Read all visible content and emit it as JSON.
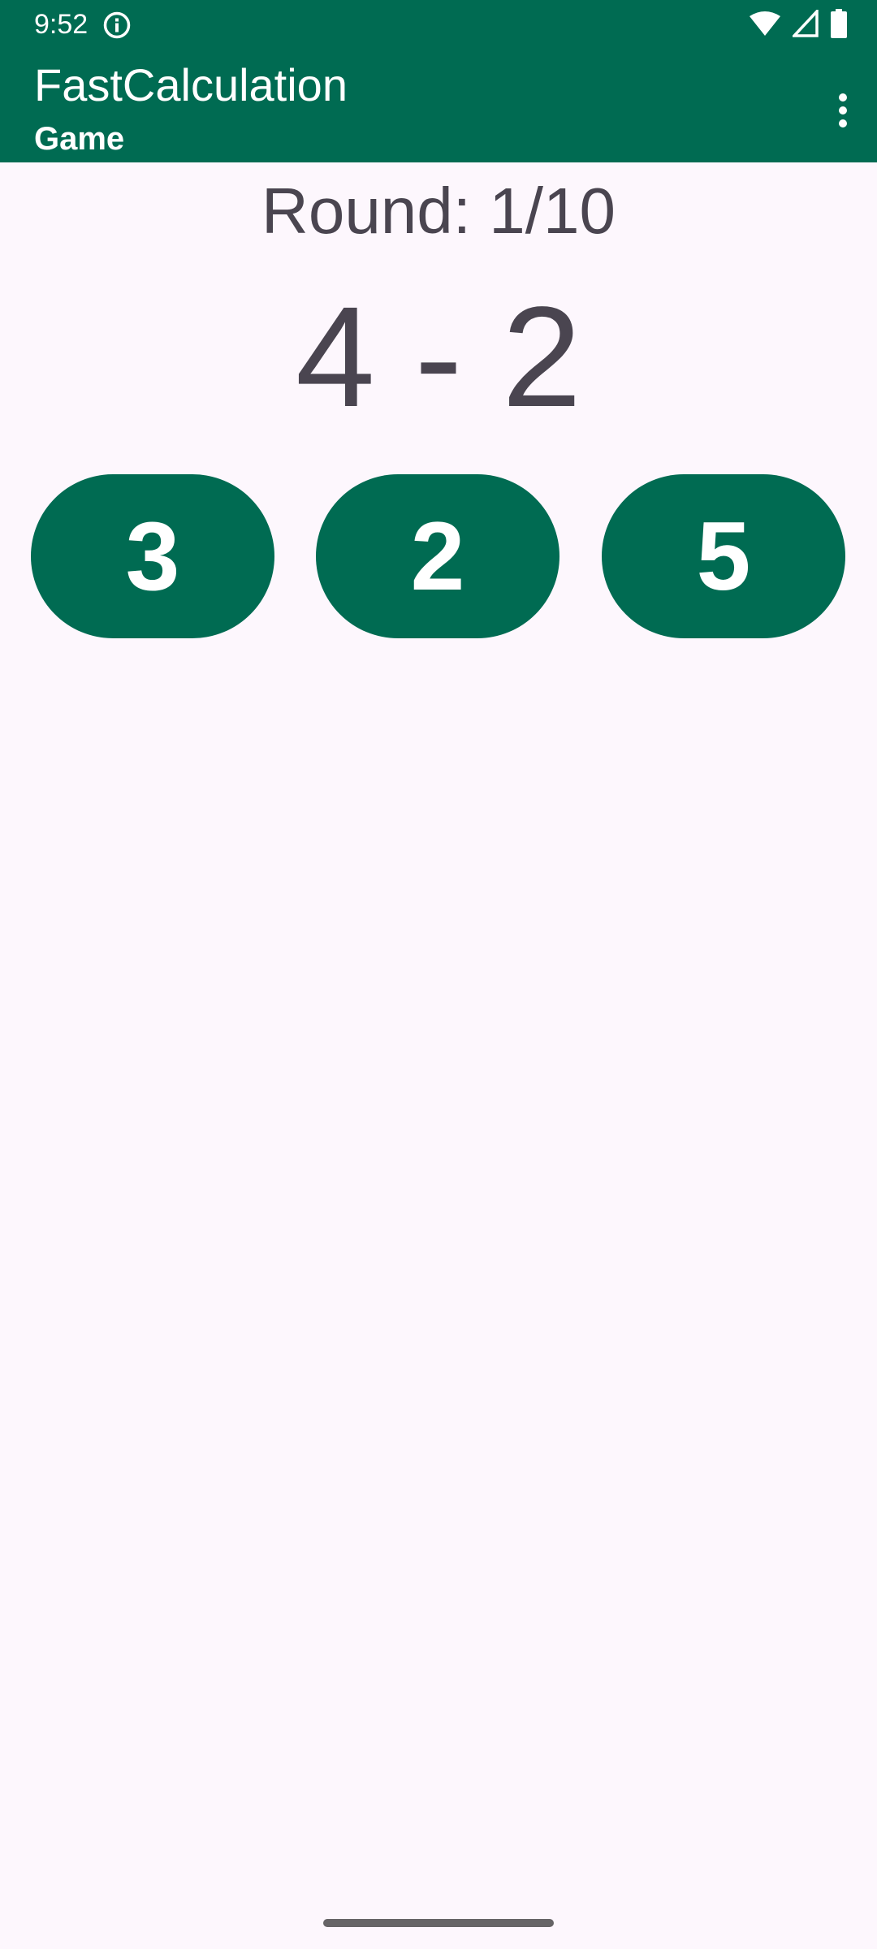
{
  "status_bar": {
    "time": "9:52",
    "icons": [
      "info-icon",
      "wifi-icon",
      "signal-icon",
      "battery-icon"
    ]
  },
  "app_bar": {
    "title": "FastCalculation",
    "subtitle": "Game",
    "overflow_icon": "more-vert-icon"
  },
  "game": {
    "round": "Round: 1/10",
    "equation": "4 - 2",
    "answers": [
      "3",
      "2",
      "5"
    ]
  },
  "colors": {
    "primary": "#006B52",
    "background": "#FDF7FD",
    "text": "#4A4550"
  }
}
